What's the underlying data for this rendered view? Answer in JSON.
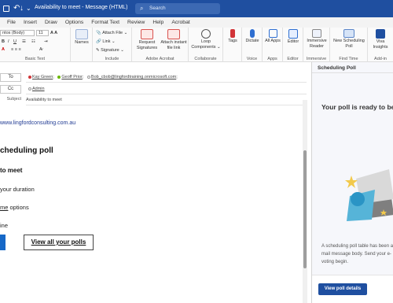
{
  "titlebar": {
    "title": "Availability to meet  -  Message (HTML)",
    "search_placeholder": "Search",
    "save_icon": "save-icon",
    "undo_icon": "undo-icon",
    "redo_icon": "redo-icon"
  },
  "menu": [
    "File",
    "Insert",
    "Draw",
    "Options",
    "Format Text",
    "Review",
    "Help",
    "Acrobat"
  ],
  "ribbon": {
    "font_name": "ntos (Body)",
    "font_size": "11",
    "basic_text_label": "Basic Text",
    "names_label": "Names",
    "attach_file": "Attach File",
    "link": "Link",
    "signature": "Signature",
    "include_label": "Include",
    "request_signatures": "Request Signatures",
    "attach_instant": "Attach instant file link",
    "adobe_label": "Adobe Acrobat",
    "loop_components": "Loop Components",
    "collaborate_label": "Collaborate",
    "tags": "Tags",
    "dictate": "Dictate",
    "voice_label": "Voice",
    "all_apps": "All Apps",
    "apps_label": "Apps",
    "editor": "Editor",
    "editor_label": "Editor",
    "immersive_reader": "Immersive Reader",
    "immersive_label": "Immersive",
    "new_scheduling_poll": "New Scheduling Poll",
    "find_time_label": "Find Time",
    "viva_insights": "Viva Insights",
    "addin_label": "Add-in"
  },
  "compose": {
    "to_label": "To",
    "cc_label": "Cc",
    "subject_label": "Subject",
    "recipients": [
      {
        "name": "Kay Green",
        "status_color": "#d13438"
      },
      {
        "name": "Geoff Prior",
        "status_color": "#6bb700"
      },
      {
        "name": "Bob_cbob@lingfordtraining.onmicrosoft.com",
        "status_color": "#c8c8c8"
      }
    ],
    "cc_recipient": "Admin",
    "subject": "Availability to meet"
  },
  "body": {
    "website": "www.lingfordconsulting.com.au",
    "heading": "cheduling poll",
    "subheading": "to meet",
    "line1": "your duration",
    "line2_underlined": "me",
    "line2_rest": " options",
    "line3": "ine",
    "view_all_polls": "View all your polls"
  },
  "pane": {
    "title": "Scheduling Poll",
    "ready_text": "Your poll is ready to be",
    "description": "A scheduling poll table has been added to your mail message body. Send your e-mail to start voting begin.",
    "desc_line1": "A scheduling poll table has been a",
    "desc_line2": "mail message body. Send your e-",
    "desc_line3": "voting begin.",
    "view_details": "View poll details",
    "accent": "#1f4fa0"
  },
  "colors": {
    "brand": "#1f4fa0",
    "link": "#1f3a93",
    "button_blue": "#1668c7"
  }
}
